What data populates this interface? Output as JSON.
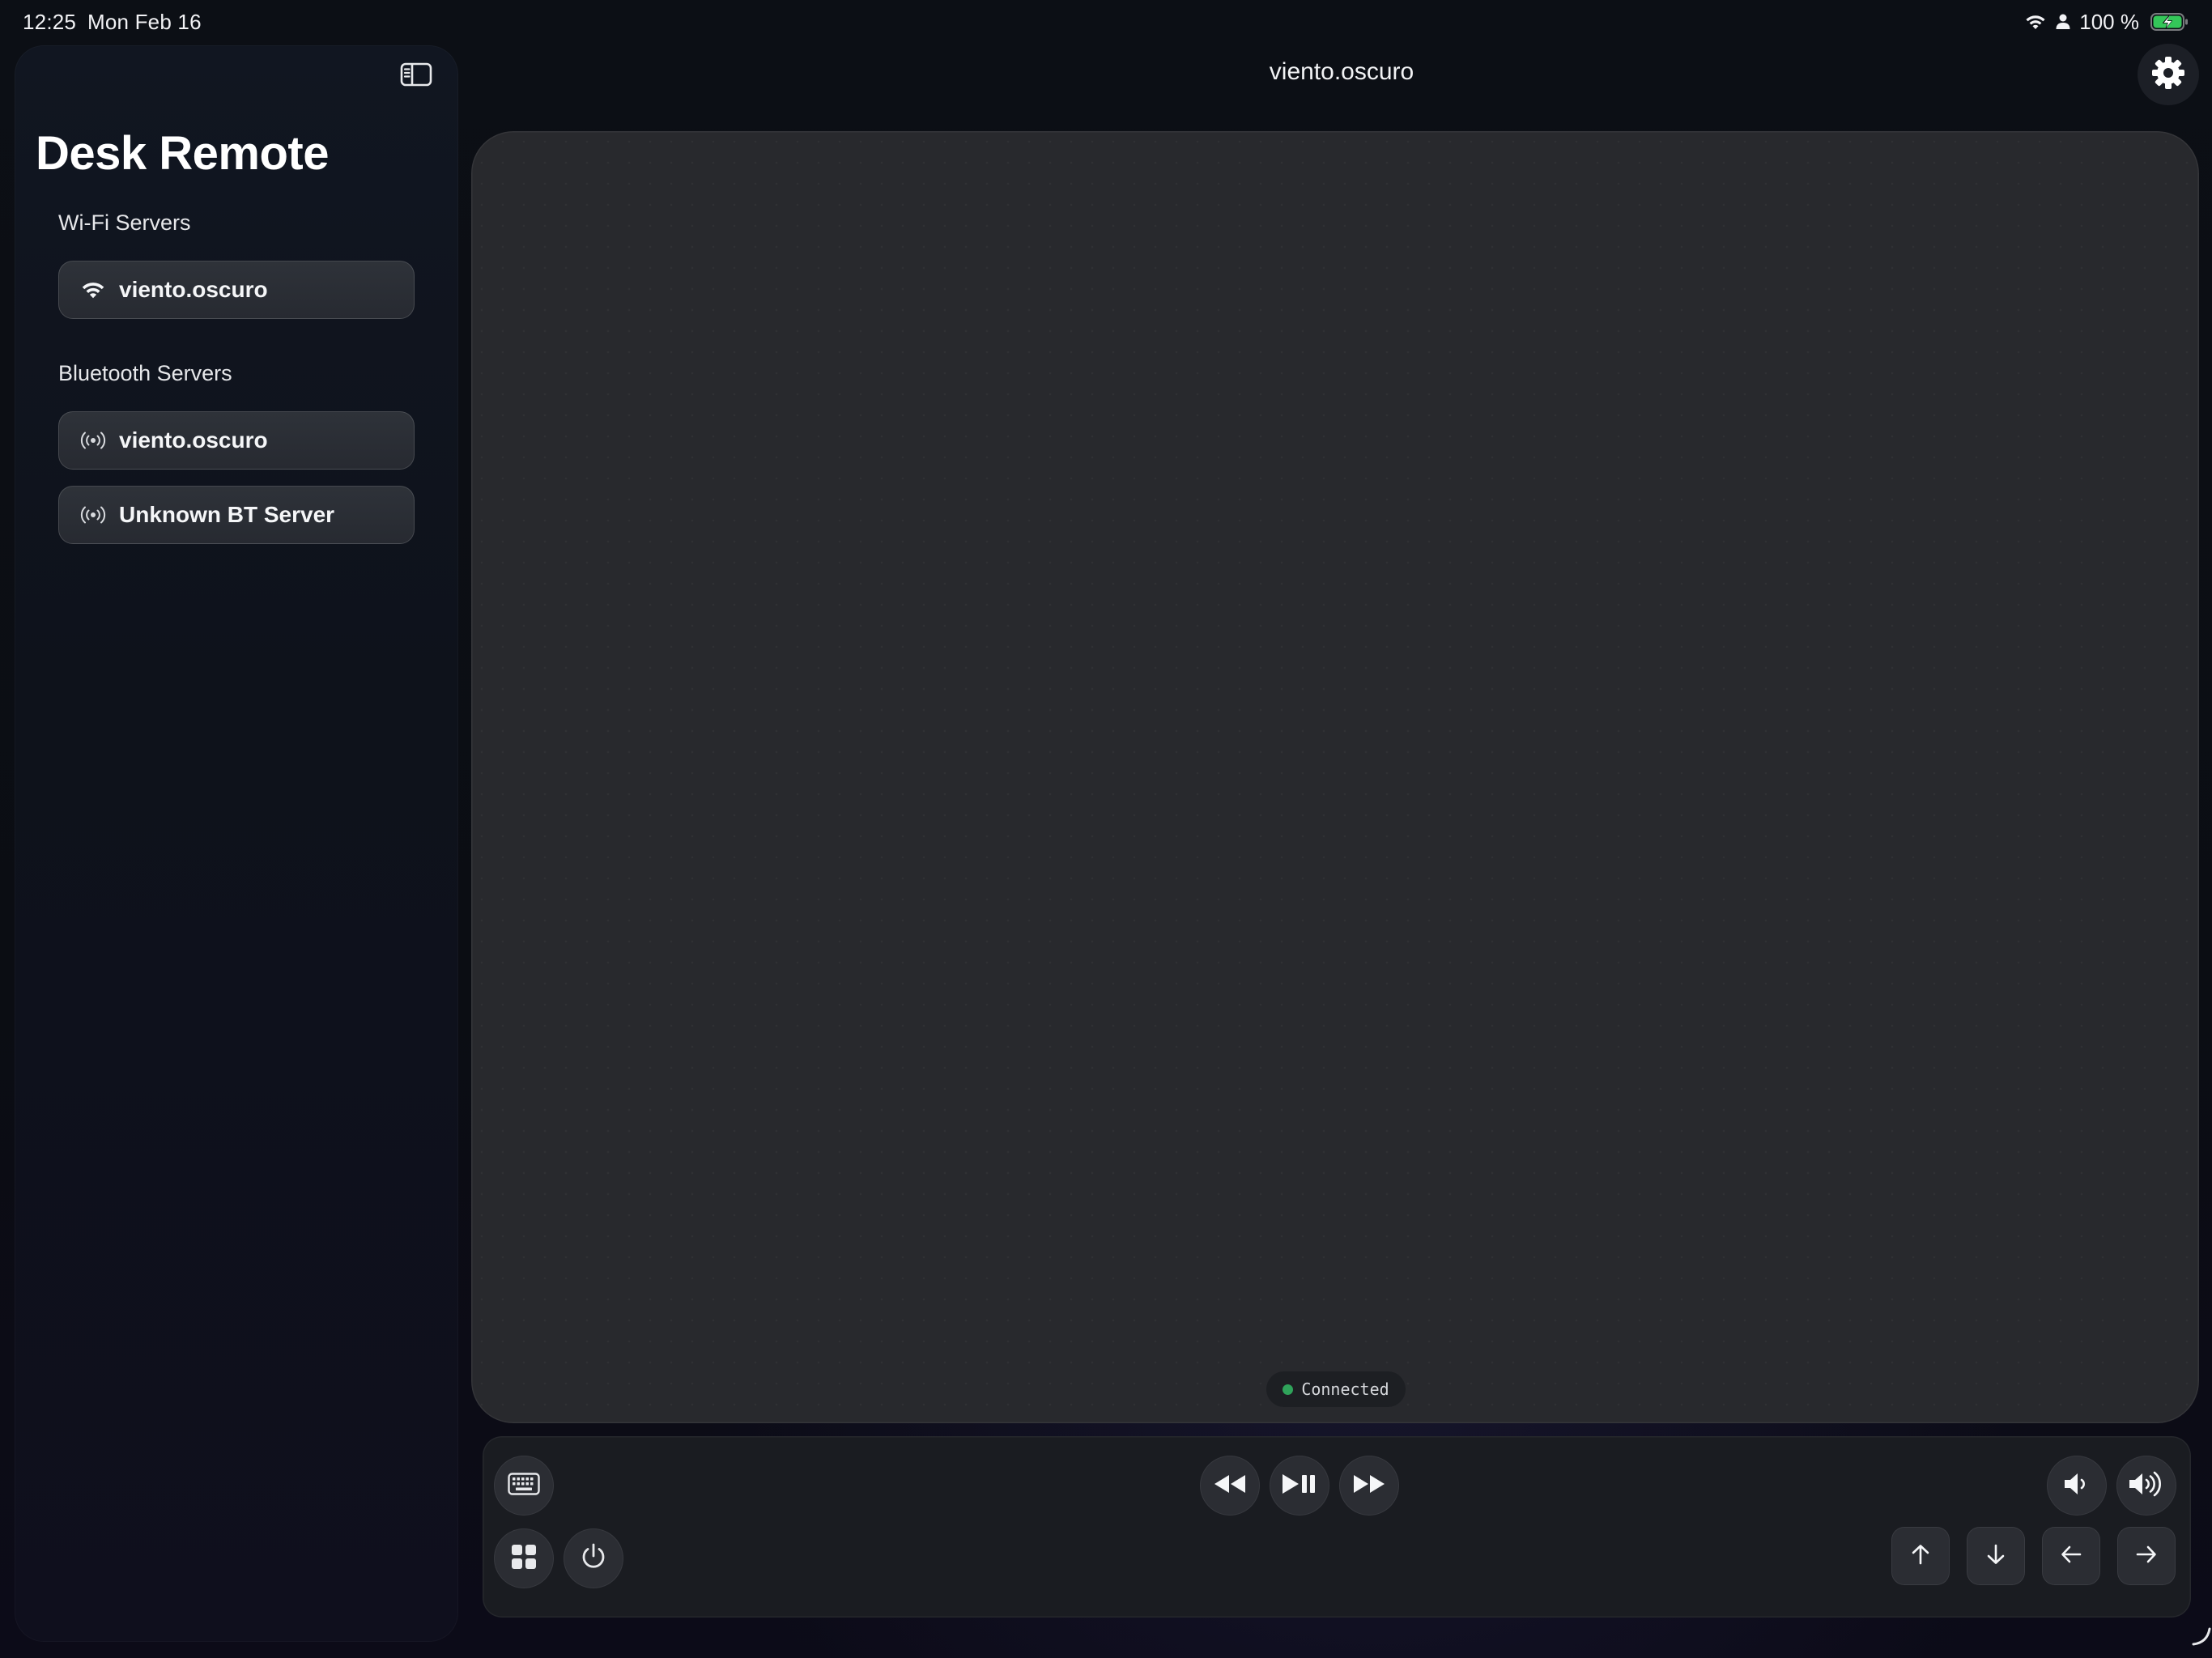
{
  "status_bar": {
    "time": "12:25",
    "date": "Mon Feb 16",
    "battery_percent": "100 %",
    "battery_level": 1.0,
    "icons": [
      "wifi-icon",
      "person-icon",
      "battery-charging-icon"
    ]
  },
  "sidebar": {
    "toggle_icon": "sidebar-toggle-icon",
    "title": "Desk Remote",
    "wifi_section_label": "Wi-Fi Servers",
    "wifi_servers": [
      {
        "label": "viento.oscuro",
        "icon": "wifi-icon"
      }
    ],
    "bluetooth_section_label": "Bluetooth Servers",
    "bluetooth_servers": [
      {
        "label": "viento.oscuro",
        "icon": "broadcast-icon"
      },
      {
        "label": "Unknown BT Server",
        "icon": "broadcast-icon"
      }
    ]
  },
  "header": {
    "title": "viento.oscuro",
    "settings_icon": "gear-icon"
  },
  "trackpad": {
    "status_text": "Connected",
    "status_color": "#2fa35a"
  },
  "controls": {
    "left": [
      "keyboard-icon",
      "grid-icon",
      "power-icon"
    ],
    "media": [
      "rewind-icon",
      "play-pause-icon",
      "fast-forward-icon"
    ],
    "volume": [
      "volume-down-icon",
      "volume-up-icon"
    ],
    "arrows": [
      "arrow-up-icon",
      "arrow-down-icon",
      "arrow-left-icon",
      "arrow-right-icon"
    ]
  },
  "colors": {
    "accent_green": "#2fa35a",
    "battery_green": "#34c759",
    "background": "#0b0d13",
    "trackpad": "#28292d"
  }
}
